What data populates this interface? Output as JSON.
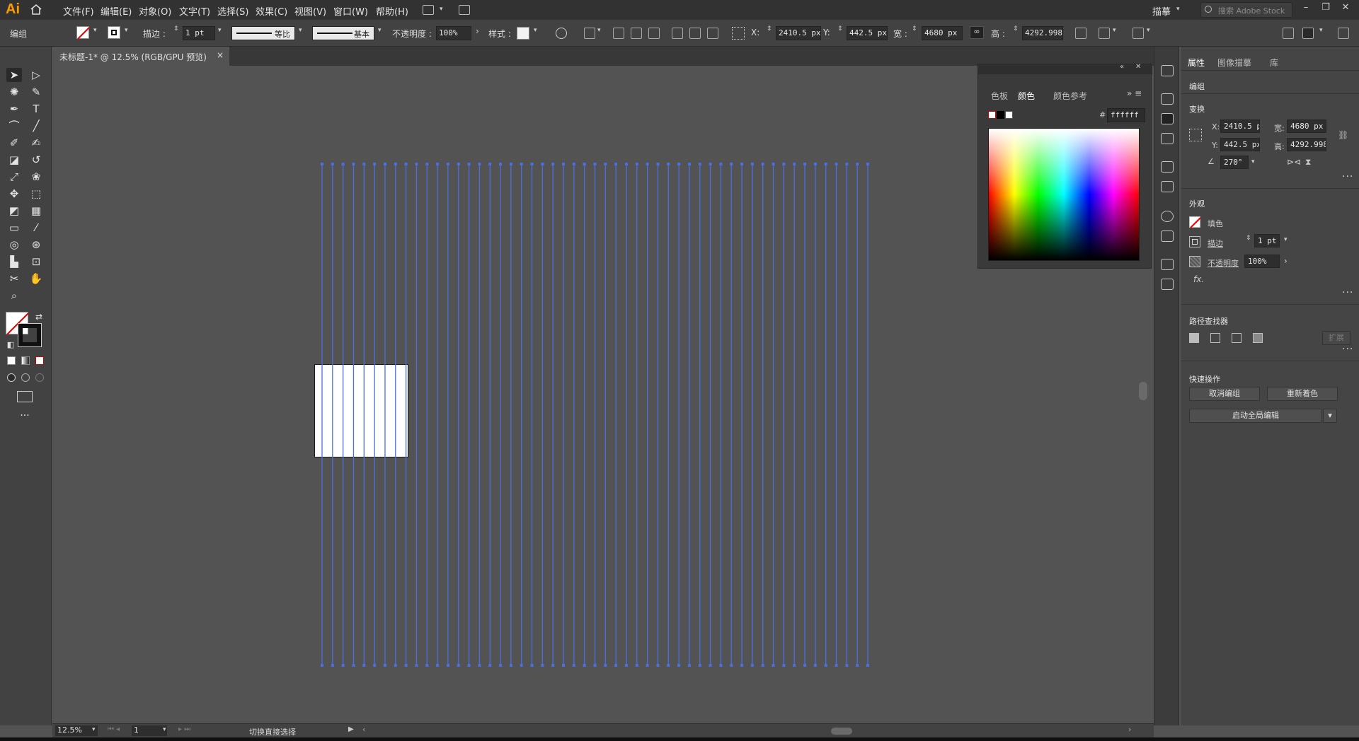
{
  "app": {
    "logo": "Ai"
  },
  "menu": {
    "items": [
      "文件(F)",
      "编辑(E)",
      "对象(O)",
      "文字(T)",
      "选择(S)",
      "效果(C)",
      "视图(V)",
      "窗口(W)",
      "帮助(H)"
    ],
    "workspace": "描摹",
    "search_placeholder": "搜索 Adobe Stock"
  },
  "controlbar": {
    "selection_label": "编组",
    "stroke_label": "描边 :",
    "stroke_value": "1 pt",
    "stroke_profile": "等比",
    "brush_label": "基本",
    "opacity_label": "不透明度 :",
    "opacity_value": "100%",
    "style_label": "样式 :",
    "x_label": "X:",
    "x_value": "2410.5 px",
    "y_label": "Y:",
    "y_value": "442.5 px",
    "w_label": "宽 :",
    "w_value": "4680 px",
    "h_label": "高 :",
    "h_value": "4292.998"
  },
  "document": {
    "tab_title": "未标题-1* @ 12.5% (RGB/GPU 预览)",
    "close": "×"
  },
  "color_panel": {
    "tabs": [
      "色板",
      "颜色",
      "颜色参考"
    ],
    "active_tab": "颜色",
    "hex_label": "#",
    "hex_value": "ffffff"
  },
  "properties": {
    "tabs": [
      "属性",
      "图像描摹",
      "库"
    ],
    "active_tab": "属性",
    "object_type": "编组",
    "transform_title": "变换",
    "x_label": "X:",
    "x_value": "2410.5 p",
    "y_label": "Y:",
    "y_value": "442.5 px",
    "w_label": "宽:",
    "w_value": "4680 px",
    "h_label": "高:",
    "h_value": "4292.998",
    "angle_value": "270°",
    "appearance_title": "外观",
    "fill_label": "填色",
    "stroke_label": "描边",
    "stroke_value": "1 pt",
    "opacity_label": "不透明度",
    "opacity_value": "100%",
    "fx_label": "fx.",
    "pathfinder_title": "路径查找器",
    "expand_label": "扩展",
    "quick_actions_title": "快速操作",
    "ungroup_button": "取消编组",
    "recolor_button": "重新着色",
    "global_edit_button": "启动全局编辑"
  },
  "statusbar": {
    "zoom": "12.5%",
    "page": "1",
    "status": "切换直接选择"
  },
  "guides": {
    "count": 53,
    "color": "#4a6fe0"
  },
  "colors": {
    "accent_logo": "#ff9a00",
    "guide": "#4a6fe0",
    "canvas": "#535353"
  }
}
